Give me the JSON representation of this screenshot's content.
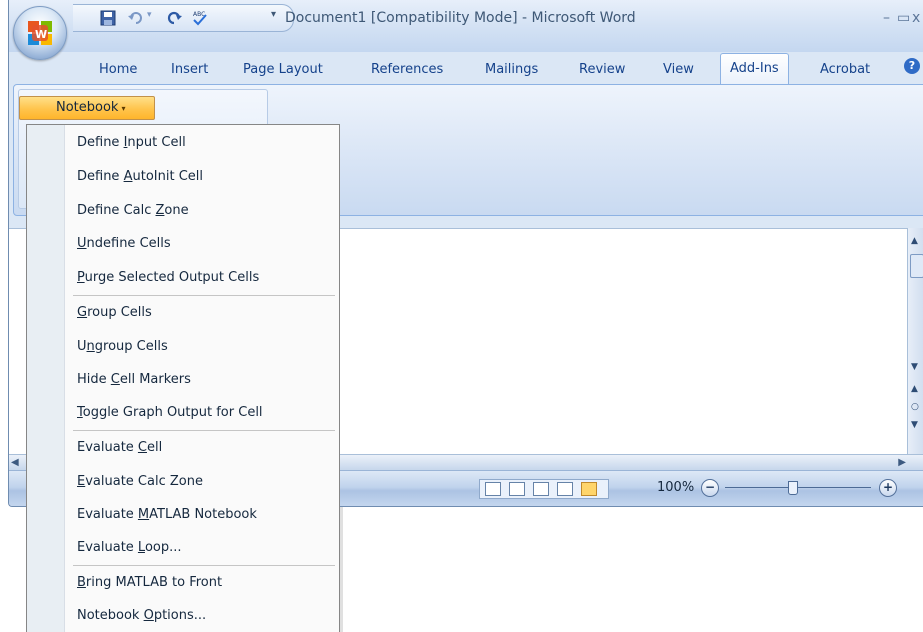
{
  "window": {
    "title": "Document1 [Compatibility Mode] - Microsoft Word",
    "minimize_glyph": "–",
    "maximize_glyph": "▭",
    "close_glyph": "x",
    "title_dropdown_glyph": "▾"
  },
  "quick_access": {
    "icons": [
      "save-icon",
      "undo-icon",
      "redo-icon",
      "spelling-icon"
    ]
  },
  "ribbon": {
    "tabs": [
      {
        "label": "Home"
      },
      {
        "label": "Insert"
      },
      {
        "label": "Page Layout"
      },
      {
        "label": "References"
      },
      {
        "label": "Mailings"
      },
      {
        "label": "Review"
      },
      {
        "label": "View"
      },
      {
        "label": "Add-Ins",
        "active": true
      },
      {
        "label": "Acrobat"
      }
    ],
    "help_glyph": "?",
    "notebook_button": {
      "label": "Notebook",
      "caret": "▾"
    }
  },
  "menu": {
    "items": [
      {
        "pre": "Define ",
        "key": "I",
        "post": "nput Cell"
      },
      {
        "pre": "Define ",
        "key": "A",
        "post": "utoInit Cell"
      },
      {
        "pre": "Define Calc ",
        "key": "Z",
        "post": "one"
      },
      {
        "pre": "",
        "key": "U",
        "post": "ndefine Cells"
      },
      {
        "pre": "",
        "key": "P",
        "post": "urge Selected Output Cells"
      },
      {
        "pre": "",
        "key": "G",
        "post": "roup Cells"
      },
      {
        "pre": "U",
        "key": "n",
        "post": "group Cells"
      },
      {
        "pre": "Hide ",
        "key": "C",
        "post": "ell Markers"
      },
      {
        "pre": "",
        "key": "T",
        "post": "oggle Graph Output for Cell"
      },
      {
        "pre": "Evaluate ",
        "key": "C",
        "post": "ell"
      },
      {
        "pre": "",
        "key": "E",
        "post": "valuate Calc Zone"
      },
      {
        "pre": "Evaluate ",
        "key": "M",
        "post": "ATLAB Notebook"
      },
      {
        "pre": "Evaluate ",
        "key": "L",
        "post": "oop..."
      },
      {
        "pre": "",
        "key": "B",
        "post": "ring MATLAB to Front"
      },
      {
        "pre": "Notebook ",
        "key": "O",
        "post": "ptions..."
      }
    ]
  },
  "statusbar": {
    "zoom": "100%",
    "zoom_minus": "−",
    "zoom_plus": "+",
    "zoom_level_percent": 100
  },
  "colors": {
    "accent_orange": "#ffc44c",
    "ribbon_blue": "#dbe7f5",
    "tab_text": "#15428b"
  }
}
